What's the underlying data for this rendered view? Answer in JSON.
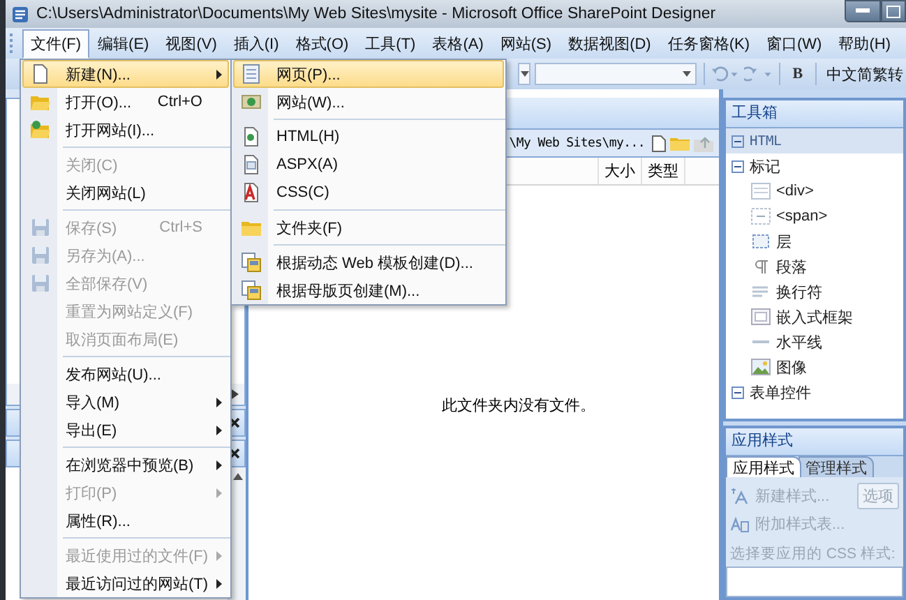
{
  "window": {
    "title": "C:\\Users\\Administrator\\Documents\\My Web Sites\\mysite - Microsoft Office SharePoint Designer"
  },
  "menu_bar": [
    {
      "label": "文件(F)",
      "selected": true
    },
    {
      "label": "编辑(E)",
      "selected": false
    },
    {
      "label": "视图(V)",
      "selected": false
    },
    {
      "label": "插入(I)",
      "selected": false
    },
    {
      "label": "格式(O)",
      "selected": false
    },
    {
      "label": "工具(T)",
      "selected": false
    },
    {
      "label": "表格(A)",
      "selected": false
    },
    {
      "label": "网站(S)",
      "selected": false
    },
    {
      "label": "数据视图(D)",
      "selected": false
    },
    {
      "label": "任务窗格(K)",
      "selected": false
    },
    {
      "label": "窗口(W)",
      "selected": false
    },
    {
      "label": "帮助(H)",
      "selected": false
    }
  ],
  "toolbar": {
    "bold_label": "B",
    "convert_label": "中文简繁转"
  },
  "file_menu": {
    "groups": [
      [
        {
          "label": "新建(N)...",
          "selected": true,
          "disabled": false,
          "has_submenu": true
        },
        {
          "label": "打开(O)...",
          "shortcut": "Ctrl+O",
          "selected": false,
          "disabled": false,
          "has_submenu": false
        },
        {
          "label": "打开网站(I)...",
          "selected": false,
          "disabled": false,
          "has_submenu": false
        }
      ],
      [
        {
          "label": "关闭(C)",
          "selected": false,
          "disabled": true,
          "has_submenu": false
        },
        {
          "label": "关闭网站(L)",
          "selected": false,
          "disabled": false,
          "has_submenu": false
        }
      ],
      [
        {
          "label": "保存(S)",
          "shortcut": "Ctrl+S",
          "selected": false,
          "disabled": true,
          "has_submenu": false
        },
        {
          "label": "另存为(A)...",
          "selected": false,
          "disabled": true,
          "has_submenu": false
        },
        {
          "label": "全部保存(V)",
          "selected": false,
          "disabled": true,
          "has_submenu": false
        },
        {
          "label": "重置为网站定义(F)",
          "selected": false,
          "disabled": true,
          "has_submenu": false
        },
        {
          "label": "取消页面布局(E)",
          "selected": false,
          "disabled": true,
          "has_submenu": false
        }
      ],
      [
        {
          "label": "发布网站(U)...",
          "selected": false,
          "disabled": false,
          "has_submenu": false
        },
        {
          "label": "导入(M)",
          "selected": false,
          "disabled": false,
          "has_submenu": true
        },
        {
          "label": "导出(E)",
          "selected": false,
          "disabled": false,
          "has_submenu": true
        }
      ],
      [
        {
          "label": "在浏览器中预览(B)",
          "selected": false,
          "disabled": false,
          "has_submenu": true
        },
        {
          "label": "打印(P)",
          "selected": false,
          "disabled": true,
          "has_submenu": true
        },
        {
          "label": "属性(R)...",
          "selected": false,
          "disabled": false,
          "has_submenu": false
        }
      ],
      [
        {
          "label": "最近使用过的文件(F)",
          "selected": false,
          "disabled": true,
          "has_submenu": true
        },
        {
          "label": "最近访问过的网站(T)",
          "selected": false,
          "disabled": false,
          "has_submenu": true
        }
      ]
    ]
  },
  "new_submenu": {
    "groups": [
      [
        {
          "label": "网页(P)...",
          "selected": true
        },
        {
          "label": "网站(W)...",
          "selected": false
        }
      ],
      [
        {
          "label": "HTML(H)",
          "selected": false
        },
        {
          "label": "ASPX(A)",
          "selected": false
        },
        {
          "label": "CSS(C)",
          "selected": false
        }
      ],
      [
        {
          "label": "文件夹(F)",
          "selected": false
        }
      ],
      [
        {
          "label": "根据动态 Web 模板创建(D)...",
          "selected": false
        },
        {
          "label": "根据母版页创建(M)...",
          "selected": false
        }
      ]
    ]
  },
  "folder_pane": {
    "path": "\\My Web Sites\\my...",
    "columns": [
      {
        "label": "大小"
      },
      {
        "label": "类型"
      }
    ],
    "empty_message": "此文件夹内没有文件。"
  },
  "toolbox": {
    "title": "工具箱",
    "tree": [
      {
        "label": "HTML",
        "expanded": true,
        "children": [
          {
            "label": "标记",
            "expanded": true,
            "children": [
              {
                "label": "<div>"
              },
              {
                "label": "<span>"
              },
              {
                "label": "层"
              },
              {
                "label": "段落"
              },
              {
                "label": "换行符"
              },
              {
                "label": "嵌入式框架"
              },
              {
                "label": "水平线"
              },
              {
                "label": "图像"
              }
            ]
          },
          {
            "label": "表单控件",
            "expanded": true
          }
        ]
      }
    ]
  },
  "styles_panel": {
    "title": "应用样式",
    "tabs": [
      {
        "label": "应用样式",
        "selected": true
      },
      {
        "label": "管理样式",
        "selected": false
      }
    ],
    "actions": [
      {
        "label": "新建样式...",
        "disabled": true
      },
      {
        "label": "附加样式表...",
        "disabled": true
      }
    ],
    "options_button": {
      "label": "选项",
      "disabled": true
    },
    "prompt": "选择要应用的 CSS 样式:"
  }
}
